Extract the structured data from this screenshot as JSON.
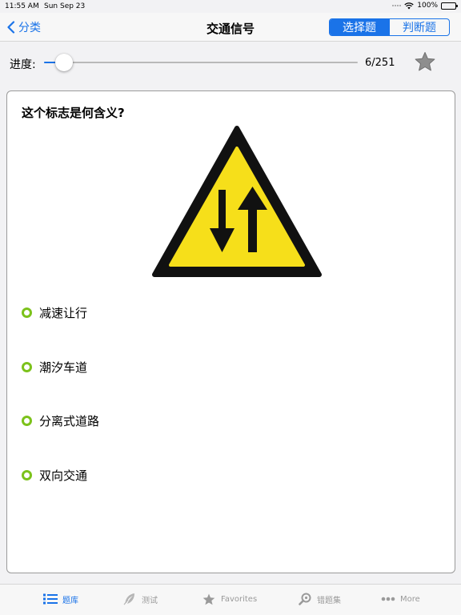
{
  "status_bar": {
    "time": "11:55 AM",
    "date": "Sun Sep 23",
    "battery": "100%",
    "battery_level": 1.0
  },
  "nav": {
    "back_label": "分类",
    "title": "交通信号",
    "segments": [
      "选择题",
      "判断题"
    ],
    "selected_segment": 0
  },
  "progress": {
    "label": "进度:",
    "current": 6,
    "total": 251,
    "count_text": "6/251"
  },
  "question": {
    "text": "这个标志是何含义?",
    "sign_icon": "two-way-traffic-warning-sign",
    "options": [
      "减速让行",
      "潮汐车道",
      "分离式道路",
      "双向交通"
    ]
  },
  "tabs": [
    {
      "label": "题库",
      "icon": "list-icon",
      "active": true
    },
    {
      "label": "测试",
      "icon": "feather-icon",
      "active": false
    },
    {
      "label": "Favorites",
      "icon": "star-icon",
      "active": false
    },
    {
      "label": "错题集",
      "icon": "search-icon",
      "active": false
    },
    {
      "label": "More",
      "icon": "more-icon",
      "active": false
    }
  ],
  "colors": {
    "accent": "#1a73e8",
    "radio": "#7cc21b",
    "sign_yellow": "#f6df1a",
    "inactive": "#9a9a9a"
  }
}
